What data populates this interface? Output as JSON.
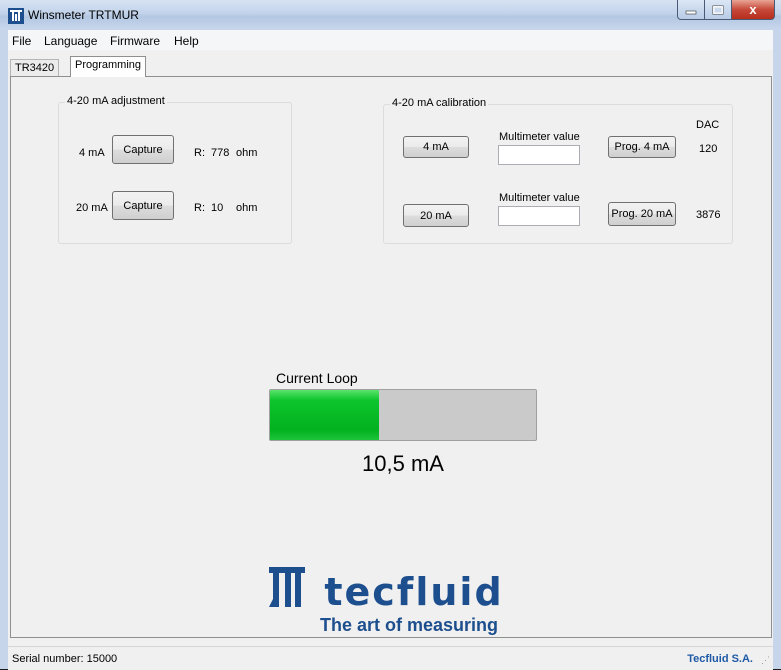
{
  "window": {
    "title": "Winsmeter TRTMUR",
    "close_label": "x"
  },
  "menu": {
    "items": [
      "File",
      "Language",
      "Firmware",
      "Help"
    ]
  },
  "tabs": [
    {
      "label": "TR3420"
    },
    {
      "label": "Programming",
      "active": true
    }
  ],
  "adjustment": {
    "title": "4-20 mA adjustment",
    "rows": [
      {
        "label": "4 mA",
        "button": "Capture",
        "r_label": "R:",
        "r_value": "778",
        "unit": "ohm"
      },
      {
        "label": "20 mA",
        "button": "Capture",
        "r_label": "R:",
        "r_value": "10",
        "unit": "ohm"
      }
    ]
  },
  "calibration": {
    "title": "4-20 mA calibration",
    "dac_header": "DAC",
    "rows": [
      {
        "button": "4 mA",
        "mm_label": "Multimeter value",
        "mm_value": "",
        "prog_button": "Prog. 4  mA",
        "dac": "120"
      },
      {
        "button": "20 mA",
        "mm_label": "Multimeter value",
        "mm_value": "",
        "prog_button": "Prog. 20 mA",
        "dac": "3876"
      }
    ]
  },
  "current_loop": {
    "label": "Current Loop",
    "value": "10,5 mA",
    "progress": 0.41,
    "fill_color": "#0ec52c"
  },
  "logo": {
    "text": "tecfluid",
    "tagline": "The art of measuring",
    "color": "#1d4f8e"
  },
  "status": {
    "serial": "Serial number: 15000",
    "company": "Tecfluid S.A."
  }
}
